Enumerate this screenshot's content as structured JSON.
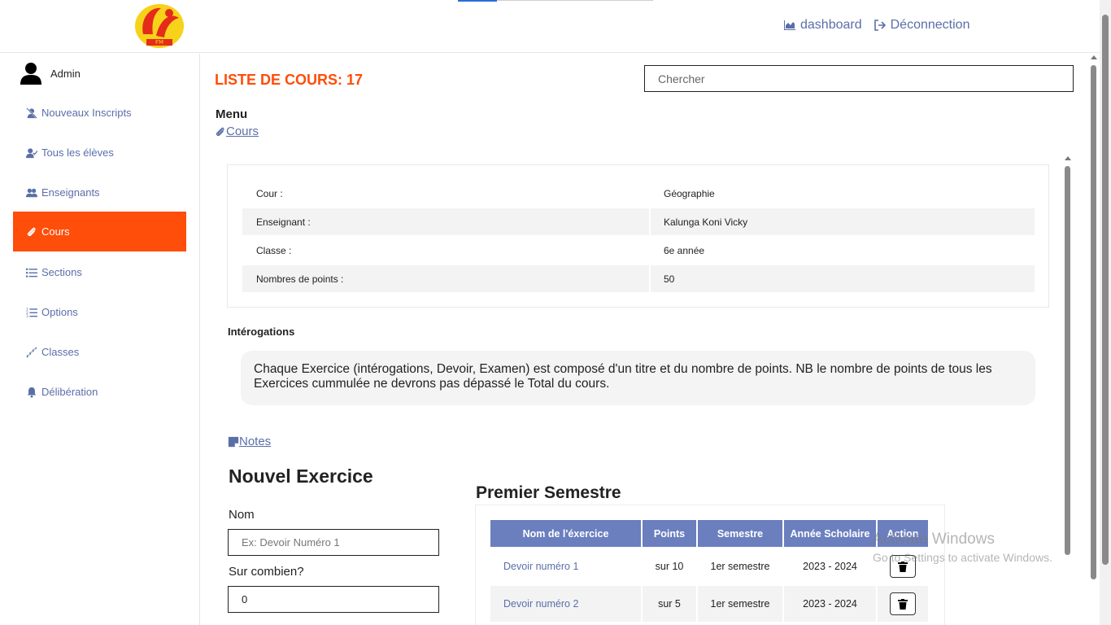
{
  "header": {
    "logo_text": "FM",
    "dashboard_label": "dashboard",
    "logout_label": "Déconnection"
  },
  "sidebar": {
    "user_label": "Admin",
    "items": [
      {
        "label": "Nouveaux Inscripts",
        "icon": "user-slash-icon"
      },
      {
        "label": "Tous les élèves",
        "icon": "user-check-icon"
      },
      {
        "label": "Enseignants",
        "icon": "users-icon"
      },
      {
        "label": "Cours",
        "icon": "paperclip-icon",
        "active": true
      },
      {
        "label": "Sections",
        "icon": "list-icon"
      },
      {
        "label": "Options",
        "icon": "list-ol-icon"
      },
      {
        "label": "Classes",
        "icon": "stairs-icon"
      },
      {
        "label": "Délibération",
        "icon": "bell-icon"
      }
    ]
  },
  "main": {
    "title": "LISTE DE COURS: 17",
    "search_placeholder": "Chercher",
    "menu_title": "Menu",
    "menu_link": "Cours",
    "course_info": [
      {
        "key": "Cour :",
        "value": "Géographie"
      },
      {
        "key": "Enseignant :",
        "value": "Kalunga Koni Vicky"
      },
      {
        "key": "Classe :",
        "value": "6e année"
      },
      {
        "key": "Nombres de points :",
        "value": "50"
      }
    ],
    "interro_title": "Intérogations",
    "interro_note": "Chaque Exercice (intérogations, Devoir, Examen) est composé d'un titre et du nombre de points. NB le nombre de points de tous les Exercices cummulée ne devrons pas dépassé le Total du cours.",
    "notes_link": "Notes",
    "new_exercise": {
      "title": "Nouvel Exercice",
      "name_label": "Nom",
      "name_placeholder": "Ex: Devoir Numéro 1",
      "points_label": "Sur combien?",
      "points_value": "0"
    },
    "semester": {
      "title": "Premier Semestre",
      "columns": [
        "Nom de l'éxercice",
        "Points",
        "Semestre",
        "Année Scholaire",
        "Action"
      ],
      "rows": [
        {
          "name": "Devoir numéro 1",
          "points": "sur 10",
          "semester": "1er semestre",
          "year": "2023 - 2024"
        },
        {
          "name": "Devoir numéro 2",
          "points": "sur 5",
          "semester": "1er semestre",
          "year": "2023 - 2024"
        }
      ]
    }
  },
  "watermark": {
    "line1": "Activate Windows",
    "line2": "Go to Settings to activate Windows."
  },
  "colors": {
    "accent": "#ff4d0a",
    "link": "#5a6fa8",
    "table_header": "#6b7fbf"
  }
}
